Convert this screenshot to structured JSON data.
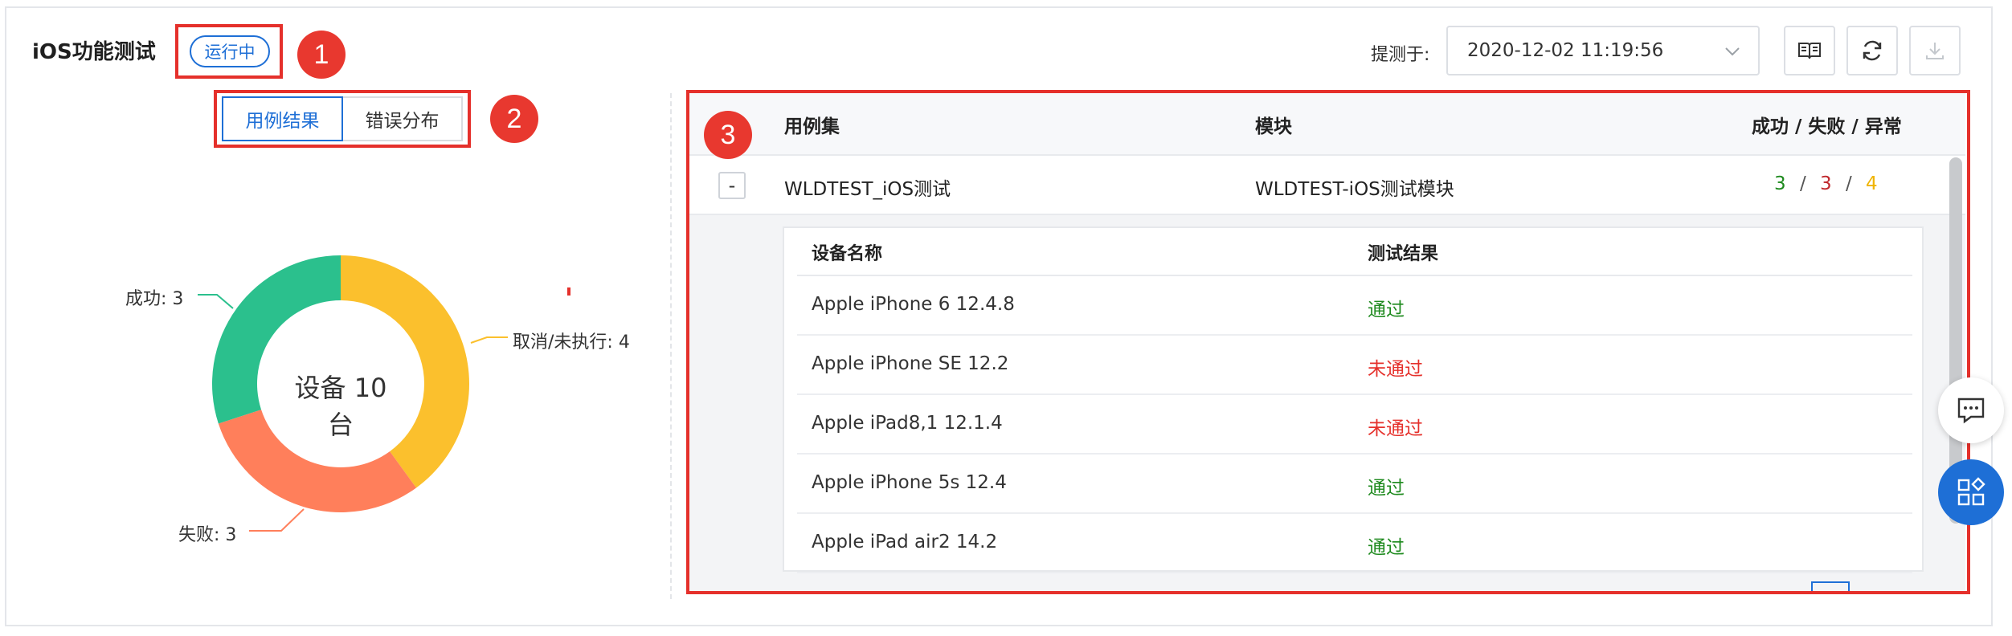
{
  "header": {
    "title": "iOS功能测试",
    "status": "运行中",
    "submitted_label": "提测于:",
    "submitted_value": "2020-12-02 11:19:56"
  },
  "annotations": {
    "one": "1",
    "two": "2",
    "three": "3"
  },
  "tabs": [
    {
      "label": "用例结果",
      "active": true
    },
    {
      "label": "错误分布",
      "active": false
    }
  ],
  "donut": {
    "center_label": "设备 10 台",
    "segments": [
      {
        "label": "成功: 3",
        "value": 3,
        "color": "#2bc08d"
      },
      {
        "label": "取消/未执行: 4",
        "value": 4,
        "color": "#fbc02d"
      },
      {
        "label": "失败: 3",
        "value": 3,
        "color": "#ff7f5b"
      }
    ]
  },
  "table": {
    "headers": {
      "suite": "用例集",
      "module": "模块",
      "stats": "成功 / 失败 / 异常"
    },
    "row": {
      "toggle": "-",
      "suite": "WLDTEST_iOS测试",
      "module": "WLDTEST-iOS测试模块",
      "success": "3",
      "fail": "3",
      "error": "4",
      "sep": "/"
    },
    "detail": {
      "headers": {
        "device": "设备名称",
        "result": "测试结果"
      },
      "rows": [
        {
          "device": "Apple iPhone 6 12.4.8",
          "result": "通过",
          "status": "pass"
        },
        {
          "device": "Apple iPhone SE 12.2",
          "result": "未通过",
          "status": "fail"
        },
        {
          "device": "Apple iPad8,1 12.1.4",
          "result": "未通过",
          "status": "fail"
        },
        {
          "device": "Apple iPhone 5s 12.4",
          "result": "通过",
          "status": "pass"
        },
        {
          "device": "Apple iPad air2 14.2",
          "result": "通过",
          "status": "pass"
        }
      ]
    }
  },
  "colors": {
    "accent": "#1e6fd6",
    "annotation_red": "#e5302b",
    "pass": "#1e8a1e",
    "fail": "#e5302b",
    "warn": "#f0b400"
  },
  "icons": [
    "book-icon",
    "refresh-icon",
    "download-icon",
    "chevron-down-icon",
    "comment-icon",
    "apps-icon"
  ]
}
